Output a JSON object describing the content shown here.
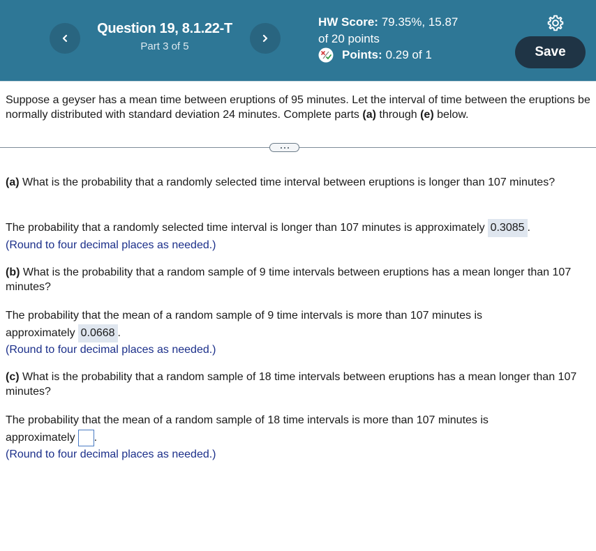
{
  "header": {
    "question_title": "Question 19, 8.1.22-T",
    "part_label": "Part 3 of 5",
    "hw_score_label": "HW Score:",
    "hw_score_value": "79.35%, 15.87",
    "hw_score_total": "of 20 points",
    "points_label": "Points:",
    "points_value": "0.29 of 1",
    "save_label": "Save",
    "prev_icon": "chevron-left-icon",
    "next_icon": "chevron-right-icon",
    "settings_icon": "gear-icon",
    "points_icon": "partial-credit-icon"
  },
  "colors": {
    "header_bg": "#2e7796",
    "save_bg": "#1f3445",
    "hint_text": "#1b2f8a",
    "answer_bg": "#dfe6ef",
    "input_border": "#4a7bc4"
  },
  "intro": {
    "text_before": "Suppose a geyser has a mean time between eruptions of 95 minutes. Let the interval of time between the eruptions be normally distributed with standard deviation 24 minutes. Complete parts ",
    "bold_a": "(a)",
    "text_mid": " through ",
    "bold_e": "(e)",
    "text_after": " below."
  },
  "parts": [
    {
      "letter": "(a)",
      "question": " What is the probability that a randomly selected time interval between eruptions is longer than 107 minutes?",
      "answer_prefix": "The probability that a randomly selected time interval is longer than 107 minutes is approximately",
      "answer_value": "0.3085",
      "answer_suffix": ".",
      "hint": "(Round to four decimal places as needed.)"
    },
    {
      "letter": "(b)",
      "question": " What is the probability that a random sample of 9 time intervals between eruptions has a mean longer than 107 minutes?",
      "answer_prefix": "The probability that the mean of a random sample of 9 time intervals is more than 107 minutes is approximately",
      "answer_value": "0.0668",
      "answer_suffix": ".",
      "hint": "(Round to four decimal places as needed.)"
    },
    {
      "letter": "(c)",
      "question": " What is the probability that a random sample of 18 time intervals between eruptions has a mean longer than 107 minutes?",
      "answer_prefix": "The probability that the mean of a random sample of 18 time intervals is more than 107 minutes is approximately",
      "answer_value": "",
      "answer_suffix": ".",
      "hint": "(Round to four decimal places as needed.)"
    }
  ]
}
